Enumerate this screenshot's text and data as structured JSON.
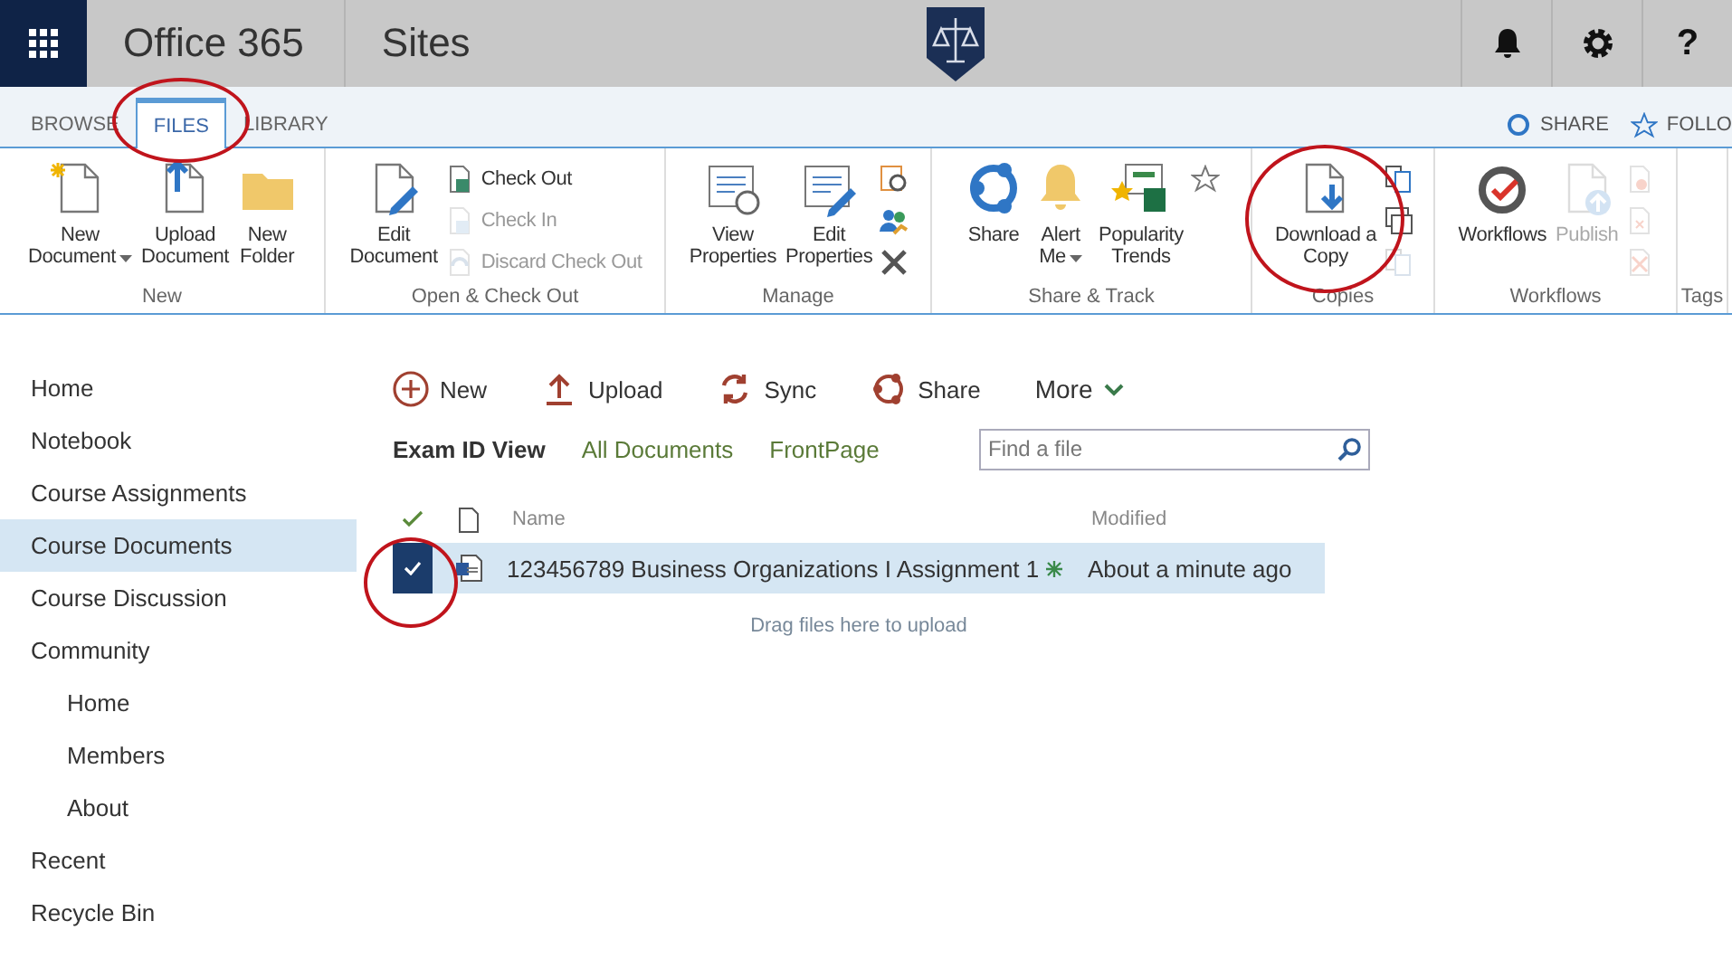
{
  "top_bar": {
    "app_name": "Office 365",
    "section": "Sites",
    "help": "?"
  },
  "ribbon_tabs": [
    {
      "label": "BROWSE",
      "selected": false
    },
    {
      "label": "FILES",
      "selected": true
    },
    {
      "label": "LIBRARY",
      "selected": false
    }
  ],
  "ribbon_actions": [
    "SHARE",
    "FOLLO"
  ],
  "ribbon_groups": [
    {
      "label": "New",
      "columns": [
        {
          "kind": "large",
          "lines": [
            "New",
            "Document"
          ],
          "dropdown": true,
          "disabled": false
        },
        {
          "kind": "large",
          "lines": [
            "Upload",
            "Document"
          ],
          "dropdown": false,
          "disabled": false
        },
        {
          "kind": "large",
          "lines": [
            "New",
            "Folder"
          ],
          "dropdown": false,
          "disabled": false
        }
      ]
    },
    {
      "label": "Open & Check Out",
      "columns": [
        {
          "kind": "large",
          "lines": [
            "Edit",
            "Document"
          ],
          "dropdown": false,
          "disabled": false
        },
        {
          "kind": "stack",
          "items": [
            {
              "kind": "small",
              "label": "Check Out",
              "disabled": false
            },
            {
              "kind": "small",
              "label": "Check In",
              "disabled": true
            },
            {
              "kind": "small",
              "label": "Discard Check Out",
              "disabled": true
            }
          ]
        }
      ]
    },
    {
      "label": "Manage",
      "columns": [
        {
          "kind": "large",
          "lines": [
            "View",
            "Properties"
          ],
          "dropdown": false,
          "disabled": false
        },
        {
          "kind": "large",
          "lines": [
            "Edit",
            "Properties"
          ],
          "dropdown": false,
          "disabled": false
        },
        {
          "kind": "stack",
          "items": [
            {
              "kind": "icon",
              "disabled": false
            },
            {
              "kind": "icon",
              "disabled": false
            },
            {
              "kind": "icon",
              "disabled": false
            }
          ]
        }
      ]
    },
    {
      "label": "Share & Track",
      "columns": [
        {
          "kind": "large",
          "lines": [
            "Share"
          ],
          "dropdown": false,
          "disabled": false
        },
        {
          "kind": "large",
          "lines": [
            "Alert",
            "Me"
          ],
          "dropdown": true,
          "disabled": false
        },
        {
          "kind": "large",
          "lines": [
            "Popularity",
            "Trends"
          ],
          "dropdown": false,
          "disabled": false
        },
        {
          "kind": "stack",
          "items": [
            {
              "kind": "icon",
              "disabled": false
            }
          ]
        }
      ]
    },
    {
      "label": "Copies",
      "columns": [
        {
          "kind": "large",
          "lines": [
            "Download a",
            "Copy"
          ],
          "dropdown": false,
          "disabled": false
        },
        {
          "kind": "stack",
          "items": [
            {
              "kind": "icon",
              "disabled": false
            },
            {
              "kind": "icon",
              "disabled": false
            },
            {
              "kind": "icon",
              "disabled": true
            }
          ]
        }
      ]
    },
    {
      "label": "Workflows",
      "columns": [
        {
          "kind": "large",
          "lines": [
            "Workflows"
          ],
          "dropdown": false,
          "disabled": false
        },
        {
          "kind": "large",
          "lines": [
            "Publish"
          ],
          "dropdown": false,
          "disabled": true
        },
        {
          "kind": "stack",
          "items": [
            {
              "kind": "icon",
              "disabled": true
            },
            {
              "kind": "icon",
              "disabled": true
            },
            {
              "kind": "icon",
              "disabled": true
            }
          ]
        }
      ]
    },
    {
      "label": "Tags"
    }
  ],
  "sidebar": {
    "items": [
      {
        "label": "Home",
        "selected": false
      },
      {
        "label": "Notebook",
        "selected": false
      },
      {
        "label": "Course Assignments",
        "selected": false
      },
      {
        "label": "Course Documents",
        "selected": true
      },
      {
        "label": "Course Discussion",
        "selected": false
      },
      {
        "label": "Community",
        "selected": false,
        "children": [
          {
            "label": "Home",
            "selected": false
          },
          {
            "label": "Members",
            "selected": false
          },
          {
            "label": "About",
            "selected": false
          }
        ]
      },
      {
        "label": "Recent",
        "selected": false
      },
      {
        "label": "Recycle Bin",
        "selected": false
      }
    ]
  },
  "command_bar": [
    {
      "label": "New"
    },
    {
      "label": "Upload"
    },
    {
      "label": "Sync"
    },
    {
      "label": "Share"
    },
    {
      "label": "More"
    }
  ],
  "views": [
    {
      "label": "Exam ID View",
      "selected": true
    },
    {
      "label": "All Documents",
      "selected": false
    },
    {
      "label": "FrontPage",
      "selected": false
    }
  ],
  "search": {
    "placeholder": "Find a file"
  },
  "table": {
    "columns": [
      "Name",
      "Modified"
    ],
    "rows": [
      {
        "selected": true,
        "name": "123456789 Business Organizations I Assignment 1",
        "new": true,
        "modified": "About a minute ago"
      }
    ]
  },
  "drop_hint": "Drag files here to upload"
}
